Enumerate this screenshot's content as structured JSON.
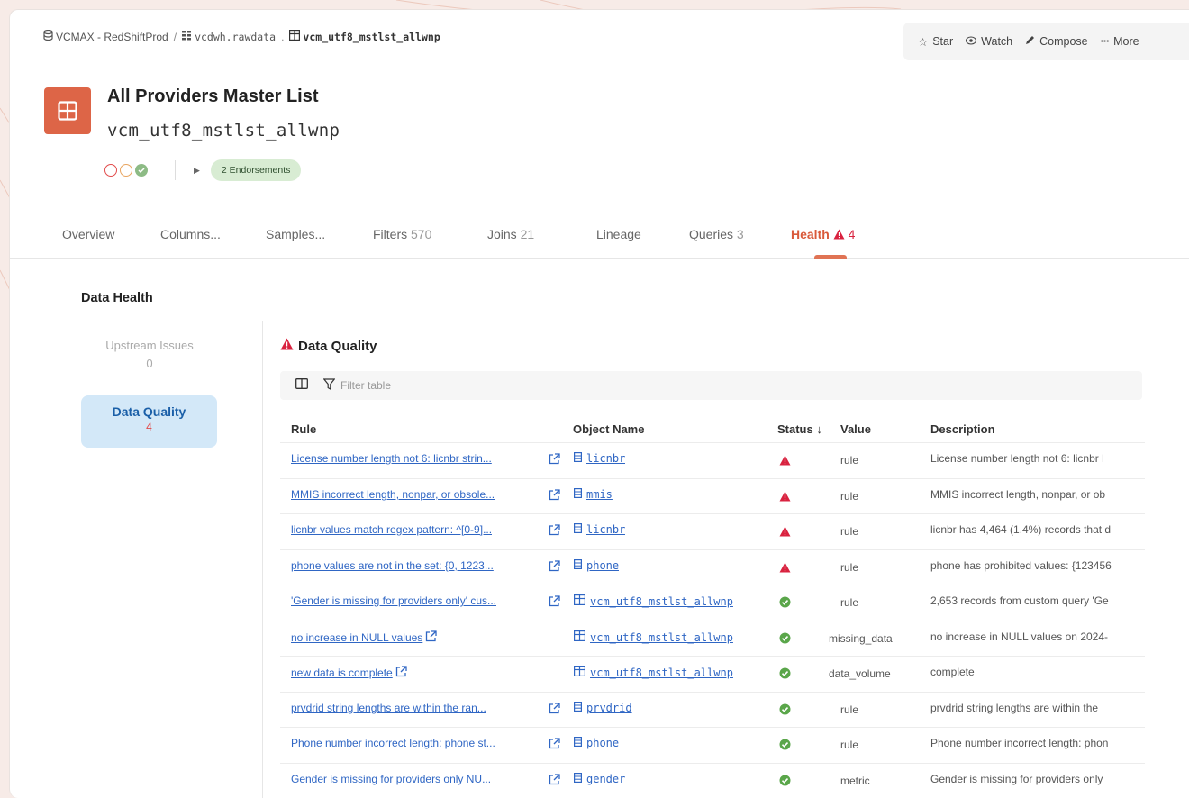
{
  "breadcrumb": {
    "source": "VCMAX - RedShiftProd",
    "schema": "vcdwh.rawdata",
    "table": "vcm_utf8_mstlst_allwnp"
  },
  "actions": {
    "star": "Star",
    "watch": "Watch",
    "compose": "Compose",
    "more": "More"
  },
  "header": {
    "title": "All Providers Master List",
    "subtitle": "vcm_utf8_mstlst_allwnp",
    "endorsements": "2 Endorsements"
  },
  "tabs": [
    {
      "label": "Overview",
      "count": ""
    },
    {
      "label": "Columns...",
      "count": ""
    },
    {
      "label": "Samples...",
      "count": ""
    },
    {
      "label": "Filters",
      "count": "570"
    },
    {
      "label": "Joins",
      "count": "21"
    },
    {
      "label": "Lineage",
      "count": ""
    },
    {
      "label": "Queries",
      "count": "3"
    },
    {
      "label": "Health",
      "count": "4",
      "active": true
    }
  ],
  "sidebar": {
    "title": "Data Health",
    "upstream_label": "Upstream Issues",
    "upstream_count": "0",
    "dq_label": "Data Quality",
    "dq_count": "4"
  },
  "main": {
    "title": "Data Quality",
    "filter_placeholder": "Filter table",
    "columns": [
      "Rule",
      "Object Name",
      "Status ↓",
      "Value",
      "Description"
    ],
    "rows": [
      {
        "rule": "License number length not 6: licnbr strin...",
        "object": "licnbr",
        "object_type": "column",
        "status": "warning",
        "value": "rule",
        "description": "License number length not 6: licnbr l"
      },
      {
        "rule": "MMIS incorrect length, nonpar, or obsole...",
        "object": "mmis",
        "object_type": "column",
        "status": "warning",
        "value": "rule",
        "description": "MMIS incorrect length, nonpar, or ob"
      },
      {
        "rule": "licnbr values match regex pattern: ^[0-9]...",
        "object": "licnbr",
        "object_type": "column",
        "status": "warning",
        "value": "rule",
        "description": "licnbr has 4,464 (1.4%) records that d"
      },
      {
        "rule": "phone values are not in the set: {0, 1223...",
        "object": "phone",
        "object_type": "column",
        "status": "warning",
        "value": "rule",
        "description": "phone has prohibited values: {123456"
      },
      {
        "rule": "'Gender is missing for providers only' cus...",
        "object": "vcm_utf8_mstlst_allwnp",
        "object_type": "table",
        "status": "ok",
        "value": "rule",
        "description": "2,653 records from custom query 'Ge"
      },
      {
        "rule": "no increase in NULL values",
        "object": "vcm_utf8_mstlst_allwnp",
        "object_type": "table",
        "status": "ok",
        "value": "missing_data",
        "description": "no increase in NULL values on 2024-"
      },
      {
        "rule": "new data is complete",
        "object": "vcm_utf8_mstlst_allwnp",
        "object_type": "table",
        "status": "ok",
        "value": "data_volume",
        "description": "complete"
      },
      {
        "rule": "prvdrid string lengths are within the ran...",
        "object": "prvdrid",
        "object_type": "column",
        "status": "ok",
        "value": "rule",
        "description": "prvdrid string lengths are within the"
      },
      {
        "rule": "Phone number incorrect length: phone st...",
        "object": "phone",
        "object_type": "column",
        "status": "ok",
        "value": "rule",
        "description": "Phone number incorrect length: phon"
      },
      {
        "rule": "Gender is missing for providers only NU...",
        "object": "gender",
        "object_type": "column",
        "status": "ok",
        "value": "metric",
        "description": "Gender is missing for providers only"
      }
    ]
  },
  "colors": {
    "accent": "#dd6547",
    "link": "#2f66c4",
    "warning": "#d9223f",
    "ok": "#5aa64a",
    "nav_active_bg": "#d3e8f8"
  }
}
